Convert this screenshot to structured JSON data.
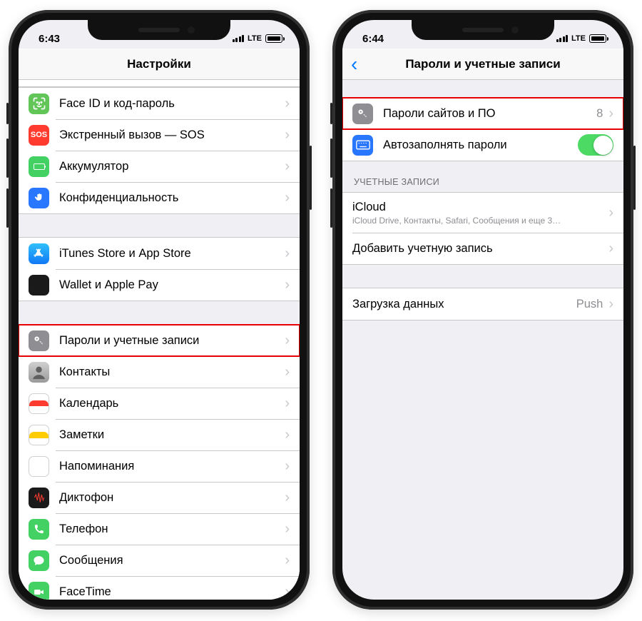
{
  "status": {
    "time_left": "6:43",
    "time_right": "6:44",
    "network": "LTE"
  },
  "left": {
    "title": "Настройки",
    "rows": {
      "faceid": "Face ID и код-пароль",
      "sos": "Экстренный вызов — SOS",
      "battery": "Аккумулятор",
      "privacy": "Конфиденциальность",
      "itunes": "iTunes Store и App Store",
      "wallet": "Wallet и Apple Pay",
      "passwords": "Пароли и учетные записи",
      "contacts": "Контакты",
      "calendar": "Календарь",
      "notes": "Заметки",
      "reminders": "Напоминания",
      "voicememo": "Диктофон",
      "phone": "Телефон",
      "messages": "Сообщения",
      "facetime": "FaceTime"
    },
    "sos_text": "SOS"
  },
  "right": {
    "title": "Пароли и учетные записи",
    "site_passwords": "Пароли сайтов и ПО",
    "site_passwords_count": "8",
    "autofill": "Автозаполнять пароли",
    "accounts_header": "УЧЕТНЫЕ ЗАПИСИ",
    "icloud": "iCloud",
    "icloud_sub": "iCloud Drive, Контакты, Safari, Сообщения и еще 3…",
    "add_account": "Добавить учетную запись",
    "fetch": "Загрузка данных",
    "fetch_value": "Push"
  }
}
